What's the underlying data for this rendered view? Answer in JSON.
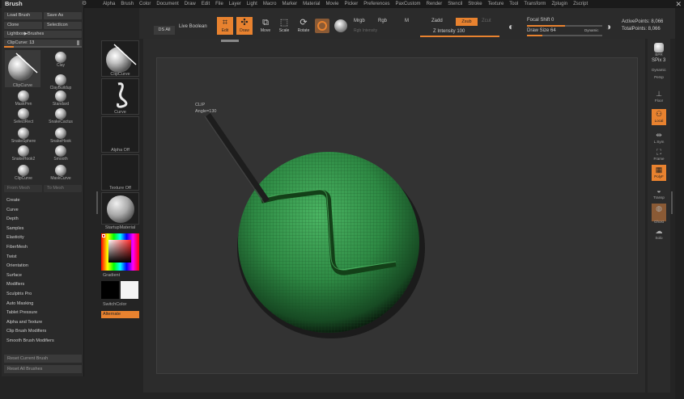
{
  "menubar": {
    "panel_title": "Brush",
    "items": [
      "Alpha",
      "Brush",
      "Color",
      "Document",
      "Draw",
      "Edit",
      "File",
      "Layer",
      "Light",
      "Macro",
      "Marker",
      "Material",
      "Movie",
      "Picker",
      "Preferences",
      "PaxCustom",
      "Render",
      "Stencil",
      "Stroke",
      "Texture",
      "Tool",
      "Transform",
      "Zplugin",
      "Zscript"
    ]
  },
  "brush_panel": {
    "buttons": {
      "load_brush": "Load Brush",
      "save_as": "Save As",
      "clone": "Clone",
      "selecticon": "SelectIcon",
      "lightbox": "Lightbox▶Brushes"
    },
    "clipcurve": {
      "label": "ClipCurve",
      "value": "13",
      "fraction": 0.13
    },
    "current_brush": "ClipCurve",
    "brushes": [
      {
        "name": "Clay"
      },
      {
        "name": "ClipCurve"
      },
      {
        "name": "ClayBuildup"
      },
      {
        "name": "MaskPen"
      },
      {
        "name": "Standard"
      },
      {
        "name": "SelectRect"
      },
      {
        "name": "SnakeCactus"
      },
      {
        "name": "SnakeSphere"
      },
      {
        "name": "SnakeHook"
      },
      {
        "name": "SnakeHook2"
      },
      {
        "name": "Smooth"
      },
      {
        "name": "ClipCurve"
      },
      {
        "name": "MaskCurve"
      }
    ],
    "from_mesh": "From Mesh",
    "to_mesh": "To Mesh",
    "menu": [
      "Create",
      "Curve",
      "Depth",
      "Samples",
      "Elasticity",
      "FiberMesh",
      "Twist",
      "Orientation",
      "Surface",
      "Modifiers",
      "Sculptris Pro",
      "Auto Masking",
      "Tablet Pressure",
      "Alpha and Texture",
      "Clip Brush Modifiers",
      "Smooth Brush Modifiers"
    ],
    "reset_current": "Reset Current Brush",
    "reset_all": "Reset All Brushes"
  },
  "palette_column": {
    "brush": "ClipCurve",
    "stroke": "Curve",
    "alpha": "Alpha Off",
    "texture": "Texture Off",
    "material": "StartupMaterial",
    "gradient": "Gradient",
    "switch_color": "SwitchColor",
    "alternate": "Alternate"
  },
  "shelf": {
    "ds_all": "DS All",
    "live_boolean": "Live Boolean",
    "edit": "Edit",
    "draw": "Draw",
    "move": "Move",
    "scale": "Scale",
    "rotate": "Rotate",
    "mrgb": "Mrgb",
    "rgb": "Rgb",
    "m": "M",
    "rgb_intensity": "Rgb Intensity",
    "zadd": "Zadd",
    "zsub": "Zsub",
    "zcut": "Zcut",
    "z_intensity": "Z Intensity 100",
    "z_intensity_value": 100,
    "focal_shift": "Focal Shift 0",
    "draw_size": "Draw Size 64",
    "dynamic": "Dynamic",
    "active_points": "ActivePoints: 8,066",
    "total_points": "TotalPoints: 8,066"
  },
  "canvas": {
    "clip_label": "CLIP",
    "angle_label": "Angle=130"
  },
  "right_rail": {
    "bpr": "BPR",
    "spix": "SPix 3",
    "dynamic": "Dynamic",
    "persp": "Persp",
    "floor": "Floor",
    "local": "Local",
    "lsym": "L.Sym",
    "frame": "Frame",
    "move": "Move",
    "polyf": "PolyF",
    "transp": "Transp",
    "ghost": "Ghost",
    "solo": "Solo"
  },
  "colors": {
    "accent": "#e8822f",
    "mesh": "#3f9a55",
    "canvas": "#333333"
  }
}
